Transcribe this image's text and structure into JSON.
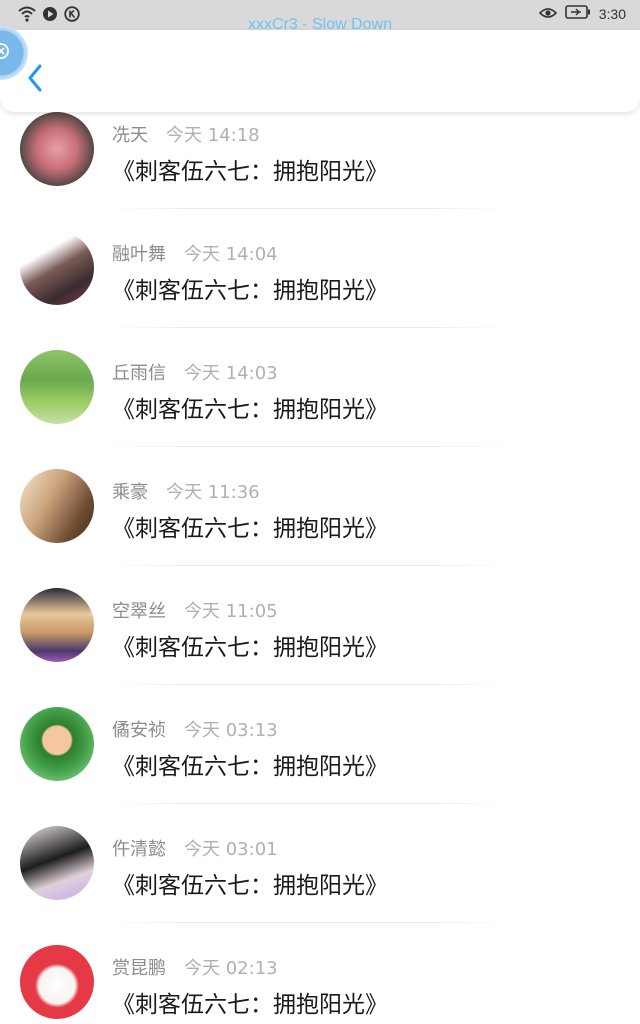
{
  "status_bar": {
    "title": "xxxCr3 - Slow Down",
    "time": "3:30",
    "icons": [
      "wifi-icon",
      "play-icon",
      "k-circle-icon",
      "eye-icon",
      "battery-icon"
    ]
  },
  "header": {
    "back_icon": "chevron-left-icon",
    "floating_icon": "close-circle-icon"
  },
  "colors": {
    "accent": "#2196F3",
    "status_bar_bg": "#d9d9d9",
    "title_text": "#6ec4f2",
    "name_text": "#8c8c8c",
    "time_text": "#b0b0b0",
    "content_text": "#1a1a1a"
  },
  "list": [
    {
      "name": "冼天",
      "time": "今天 14:18",
      "content": "《刺客伍六七：拥抱阳光》"
    },
    {
      "name": "融叶舞",
      "time": "今天 14:04",
      "content": "《刺客伍六七：拥抱阳光》"
    },
    {
      "name": "丘雨信",
      "time": "今天 14:03",
      "content": "《刺客伍六七：拥抱阳光》"
    },
    {
      "name": "乘豪",
      "time": "今天 11:36",
      "content": "《刺客伍六七：拥抱阳光》"
    },
    {
      "name": "空翠丝",
      "time": "今天 11:05",
      "content": "《刺客伍六七：拥抱阳光》"
    },
    {
      "name": "僪安祯",
      "time": "今天 03:13",
      "content": "《刺客伍六七：拥抱阳光》"
    },
    {
      "name": "仵清懿",
      "time": "今天 03:01",
      "content": "《刺客伍六七：拥抱阳光》"
    },
    {
      "name": "赏昆鹏",
      "time": "今天 02:13",
      "content": "《刺客伍六七：拥抱阳光》"
    }
  ]
}
